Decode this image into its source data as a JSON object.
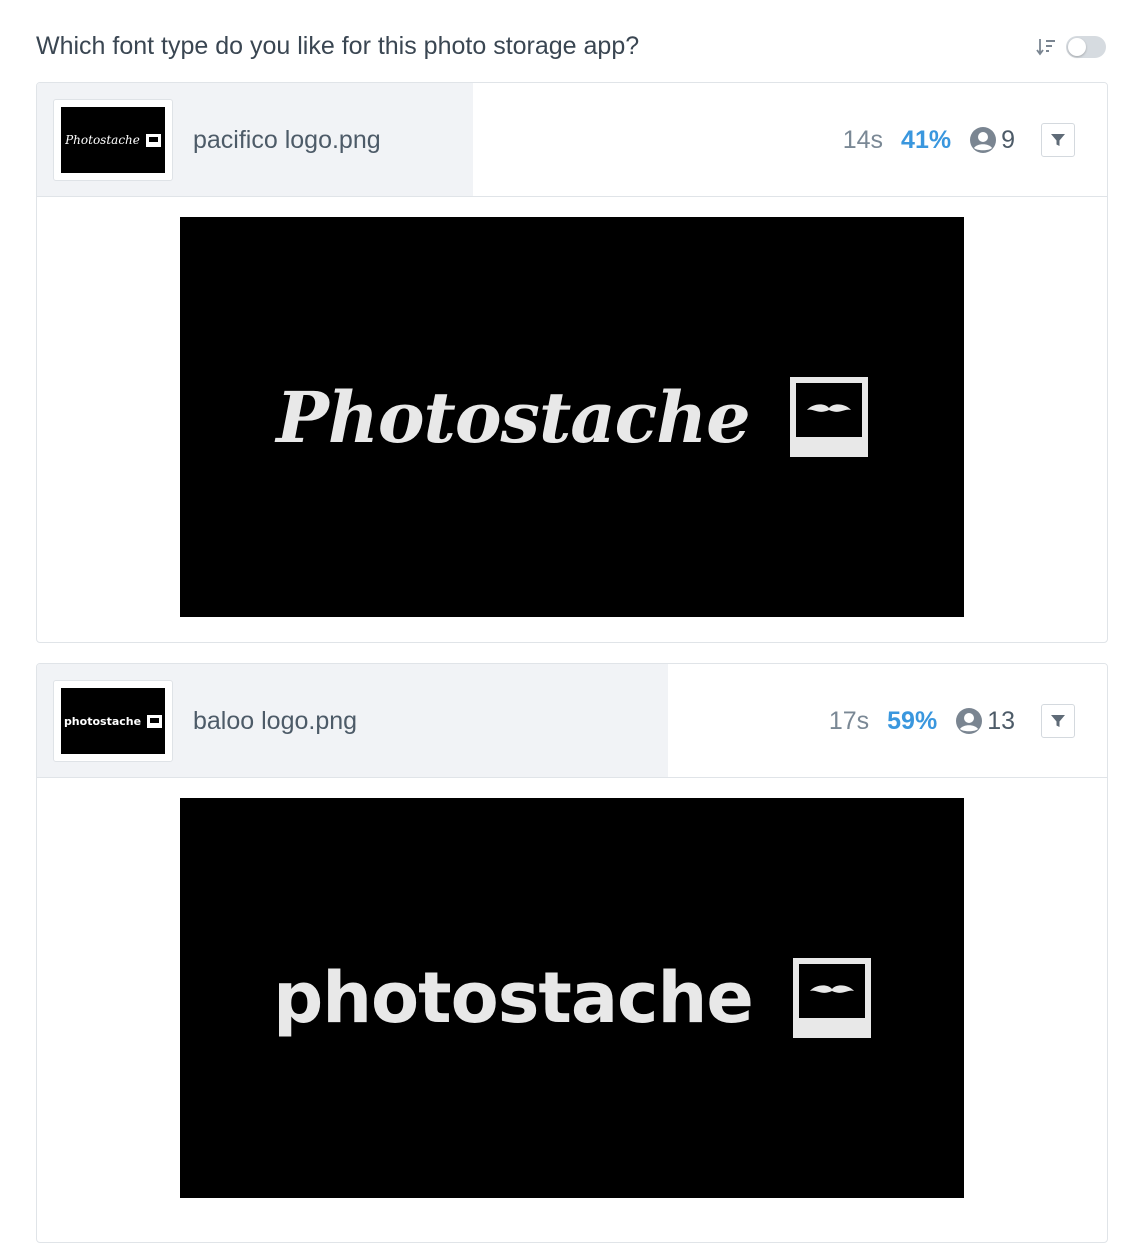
{
  "question": {
    "title": "Which font type do you like for this photo storage app?",
    "sort_icon": "sort-descending-icon",
    "toggle_on": false
  },
  "cards": [
    {
      "thumbnail_text": "Photostache",
      "file_name": "pacifico logo.png",
      "time": "14s",
      "percent": "41%",
      "percent_value": 0.41,
      "respondents": "9",
      "preview_text": "Photostache",
      "font_style": "script"
    },
    {
      "thumbnail_text": "photostache",
      "file_name": "baloo logo.png",
      "time": "17s",
      "percent": "59%",
      "percent_value": 0.59,
      "respondents": "13",
      "preview_text": "photostache",
      "font_style": "round"
    }
  ],
  "colors": {
    "accent": "#3a97de",
    "progress_fill": "#f1f3f6",
    "border": "#e0e4e8"
  }
}
